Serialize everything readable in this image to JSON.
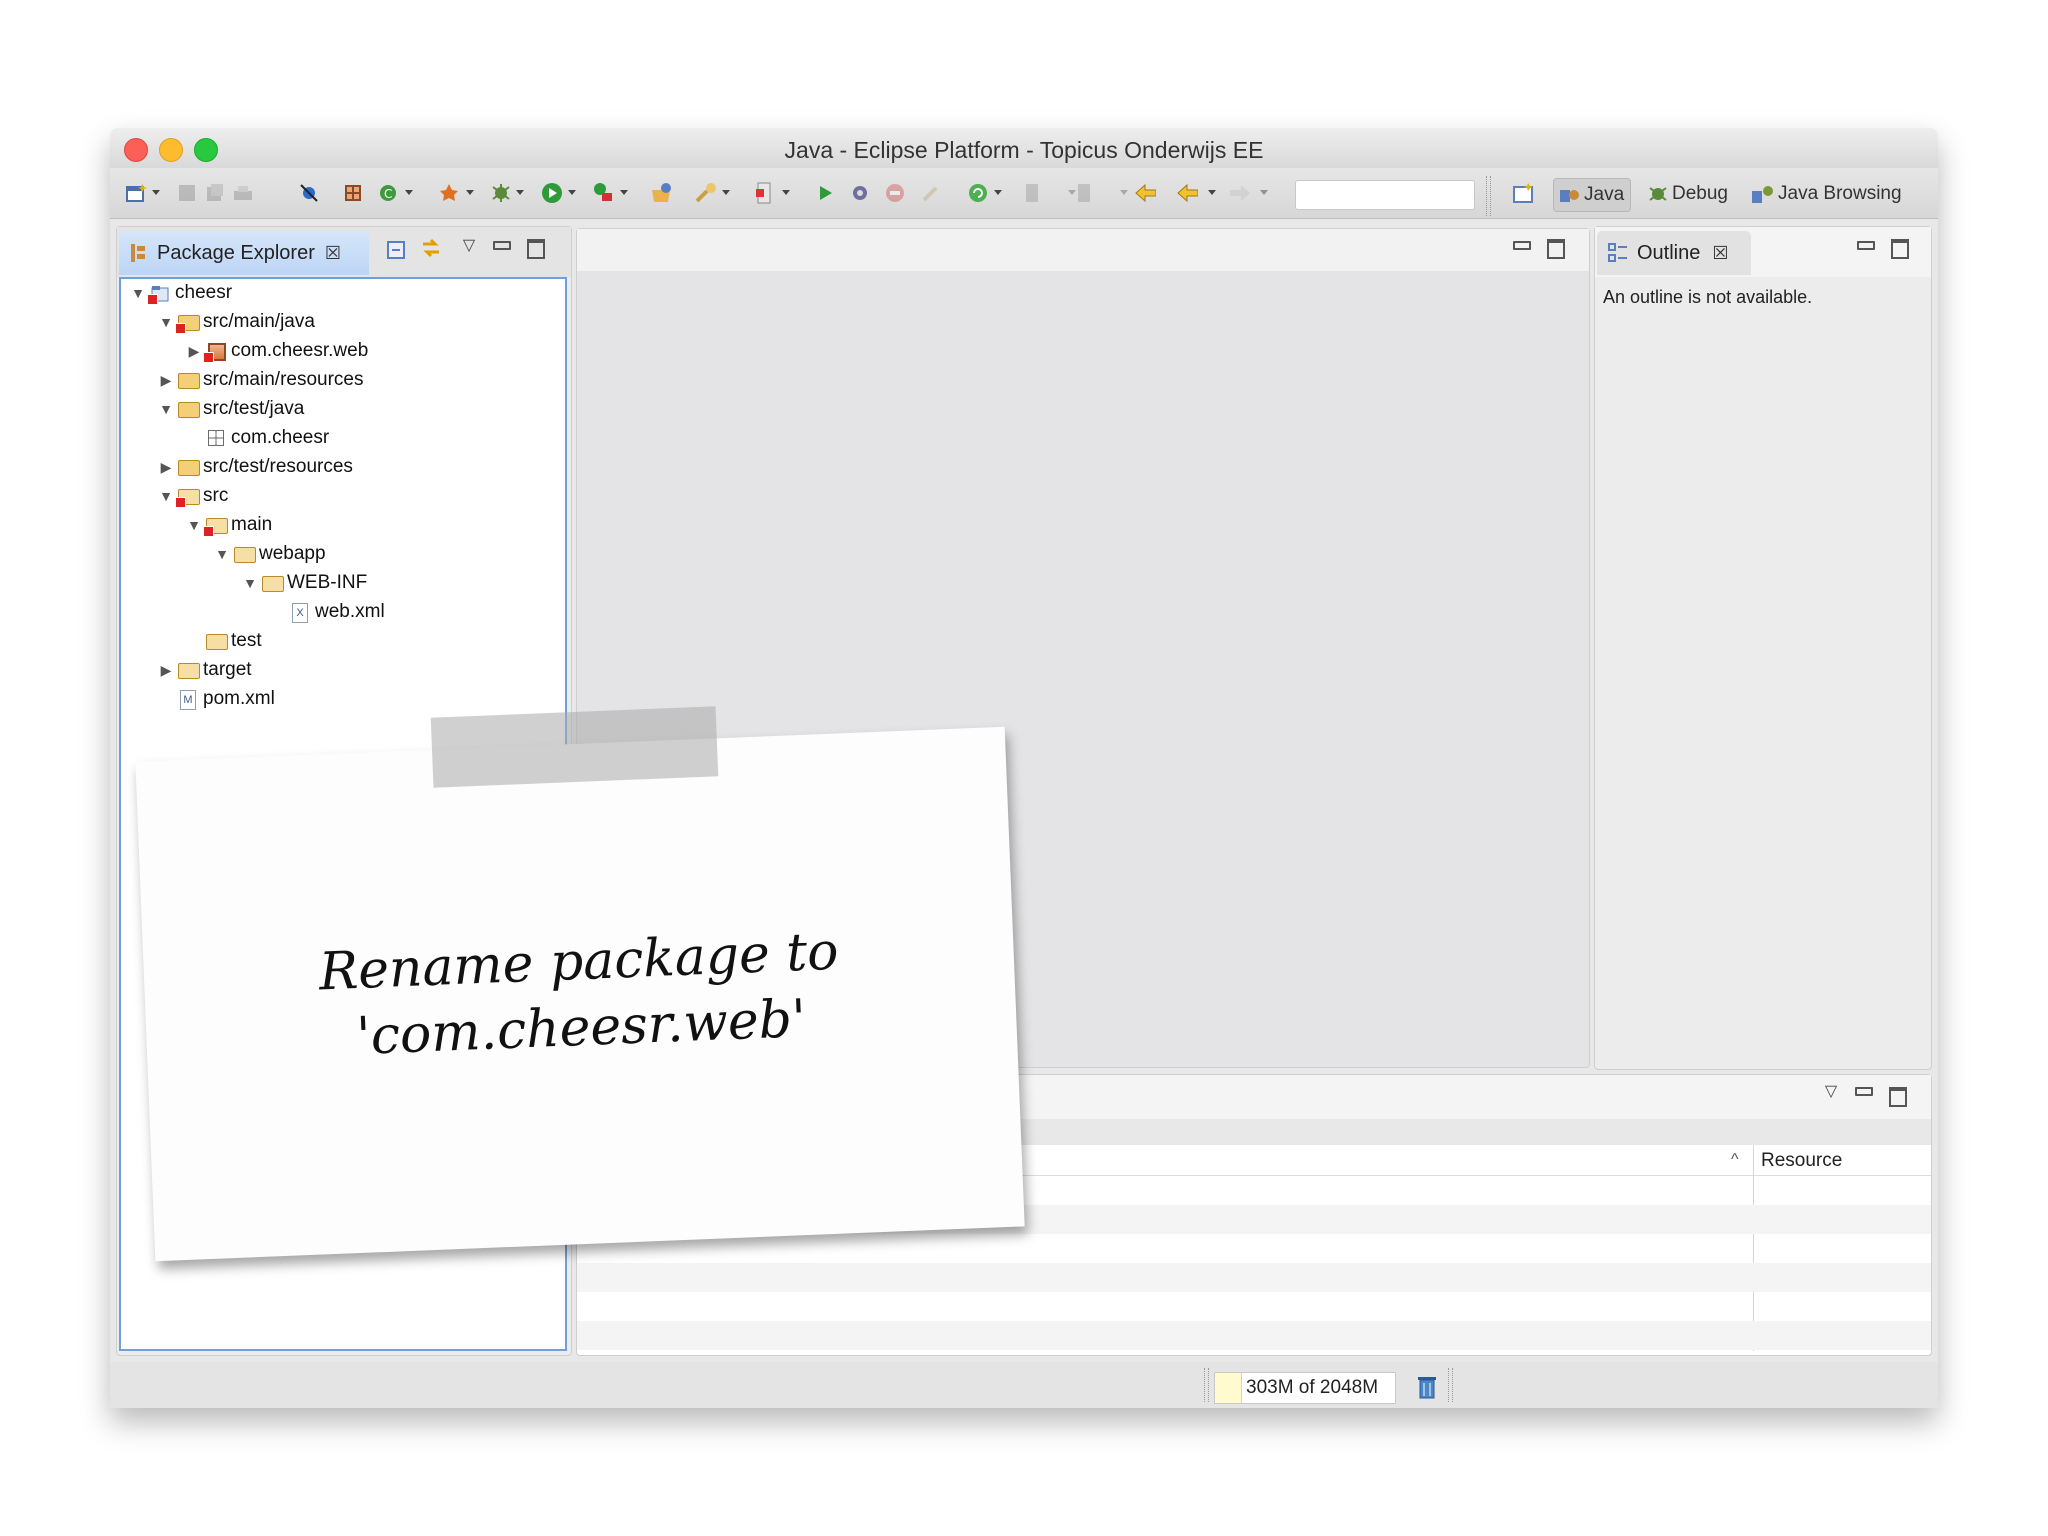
{
  "window": {
    "title": "Java - Eclipse Platform - Topicus Onderwijs EE"
  },
  "perspectives": [
    {
      "label": "Java",
      "icon": "java-perspective-icon",
      "active": true
    },
    {
      "label": "Debug",
      "icon": "debug-perspective-icon",
      "active": false
    },
    {
      "label": "Java Browsing",
      "icon": "java-browsing-perspective-icon",
      "active": false
    }
  ],
  "package_explorer": {
    "tab_label": "Package Explorer",
    "tree": [
      {
        "label": "cheesr",
        "twisty": "▼",
        "icon": "project"
      },
      {
        "label": "src/main/java",
        "twisty": "▼",
        "icon": "source-folder-error"
      },
      {
        "label": "com.cheesr.web",
        "twisty": "▶",
        "icon": "package-error"
      },
      {
        "label": "src/main/resources",
        "twisty": "▶",
        "icon": "source-folder"
      },
      {
        "label": "src/test/java",
        "twisty": "▼",
        "icon": "source-folder"
      },
      {
        "label": "com.cheesr",
        "twisty": "",
        "icon": "package-empty"
      },
      {
        "label": "src/test/resources",
        "twisty": "▶",
        "icon": "source-folder"
      },
      {
        "label": "src",
        "twisty": "▼",
        "icon": "folder-error"
      },
      {
        "label": "main",
        "twisty": "▼",
        "icon": "folder-error"
      },
      {
        "label": "webapp",
        "twisty": "▼",
        "icon": "folder"
      },
      {
        "label": "WEB-INF",
        "twisty": "▼",
        "icon": "folder"
      },
      {
        "label": "web.xml",
        "twisty": "",
        "icon": "xml-file"
      },
      {
        "label": "test",
        "twisty": "",
        "icon": "folder"
      },
      {
        "label": "target",
        "twisty": "▶",
        "icon": "folder"
      },
      {
        "label": "pom.xml",
        "twisty": "",
        "icon": "maven-file"
      }
    ]
  },
  "outline": {
    "tab_label": "Outline",
    "message": "An outline is not available."
  },
  "problems": {
    "column_resource": "Resource",
    "sort_indicator": "^"
  },
  "status_bar": {
    "heap": "303M of 2048M"
  },
  "note": {
    "line1": "Rename package to",
    "line2": "'com.cheesr.web'"
  },
  "colors": {
    "accent": "#3f7fd0",
    "close_red": "#fc5f57",
    "minimize_yellow": "#fdbc2e",
    "zoom_green": "#28c840"
  }
}
